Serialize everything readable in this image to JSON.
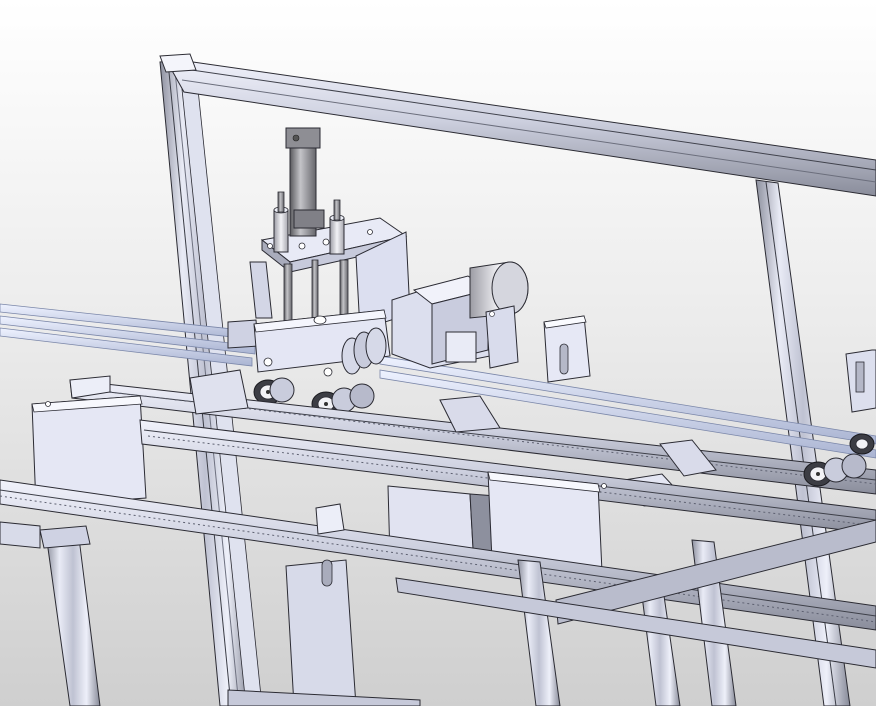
{
  "scene": {
    "subject": "cad-assembly-render",
    "colors": {
      "background_top": "#ffffff",
      "background_bottom": "#cfcfcf",
      "aluminum_light": "#e4e6f2",
      "aluminum_mid": "#c6c9d8",
      "aluminum_dark": "#7c7f8c",
      "edge": "#2b2b33",
      "cylinder": "#9a9a9a",
      "motor": "#d8d8dd",
      "tube": "#c9d2ec",
      "plate": "#e6e8f6"
    }
  }
}
